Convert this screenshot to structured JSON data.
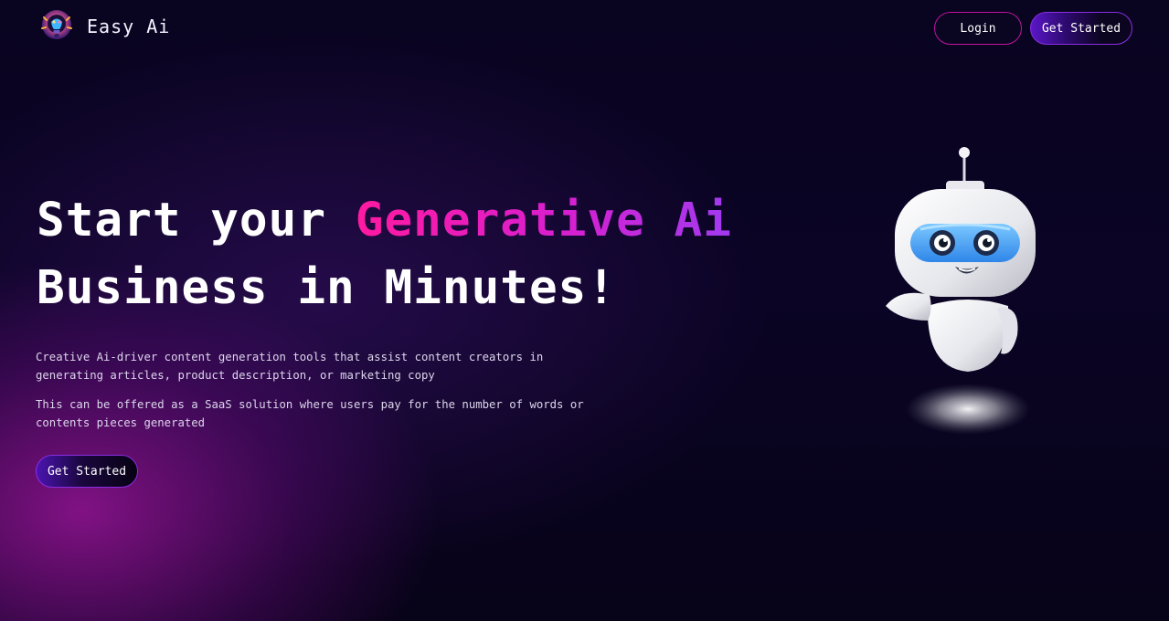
{
  "brand": {
    "name": "Easy Ai",
    "logo_icon": "lightbulb-brain-logo-icon"
  },
  "nav": {
    "login_label": "Login",
    "get_started_label": "Get Started"
  },
  "hero": {
    "title_part1": "Start your ",
    "title_accent": "Generative Ai",
    "title_part2": "Business in Minutes!",
    "description_1": "Creative Ai-driver content generation tools that assist content creators in generating articles, product description, or marketing copy",
    "description_2": "This can be offered as a SaaS solution where users pay for the number of words or contents pieces generated",
    "cta_label": "Get Started",
    "illustration_icon": "robot-mascot-icon"
  },
  "colors": {
    "background": "#07031a",
    "accent_pink": "#ff1aa0",
    "accent_purple": "#a13af0",
    "login_border": "#c0139e",
    "cta_border": "#8a2ee0"
  }
}
